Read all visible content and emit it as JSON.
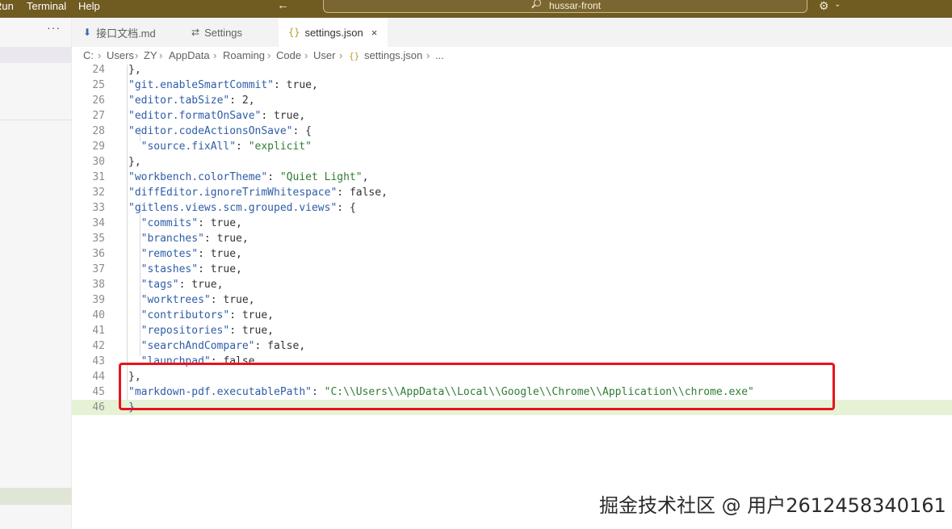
{
  "menubar": {
    "items": [
      {
        "label": "Run"
      },
      {
        "label": "Terminal"
      },
      {
        "label": "Help"
      }
    ],
    "search_text": "hussar-front"
  },
  "icons": {
    "back": "arrow-left-icon",
    "search": "search-icon",
    "account": "account-icon",
    "chevron": "chevron-down-icon",
    "more": "more-icon",
    "markdown_file": "download-arrow-icon",
    "settings": "settings-icon",
    "json_file": "json-braces-icon",
    "close": "close-icon"
  },
  "sidebar": {
    "more_label": "···"
  },
  "tabs": [
    {
      "label": "接口文档.md",
      "icon": "⬇"
    },
    {
      "label": "Settings",
      "icon": "⇄"
    },
    {
      "label": "settings.json",
      "icon": "{}",
      "close": "×"
    }
  ],
  "breadcrumb": {
    "items": [
      "C:",
      "Users",
      "ZY",
      "AppData",
      "Roaming",
      "Code",
      "User",
      "settings.json",
      "..."
    ],
    "separator": "›",
    "file_icon": "{}"
  },
  "editor": {
    "lines": [
      {
        "n": "24",
        "text": "  },"
      },
      {
        "n": "25",
        "key": "\"git.enableSmartCommit\"",
        "val": "true",
        "valtype": "kw",
        "tail": ","
      },
      {
        "n": "26",
        "key": "\"editor.tabSize\"",
        "val": "2",
        "valtype": "kw",
        "tail": ","
      },
      {
        "n": "27",
        "key": "\"editor.formatOnSave\"",
        "val": "true",
        "valtype": "kw",
        "tail": ","
      },
      {
        "n": "28",
        "key": "\"editor.codeActionsOnSave\"",
        "val": "{",
        "valtype": "kw",
        "tail": ""
      },
      {
        "n": "29",
        "key": "\"source.fixAll\"",
        "val": "\"explicit\"",
        "valtype": "str",
        "tail": "",
        "indent": 2
      },
      {
        "n": "30",
        "text": "},"
      },
      {
        "n": "31",
        "key": "\"workbench.colorTheme\"",
        "val": "\"Quiet Light\"",
        "valtype": "str",
        "tail": ","
      },
      {
        "n": "32",
        "key": "\"diffEditor.ignoreTrimWhitespace\"",
        "val": "false",
        "valtype": "kw",
        "tail": ","
      },
      {
        "n": "33",
        "key": "\"gitlens.views.scm.grouped.views\"",
        "val": "{",
        "valtype": "kw",
        "tail": ""
      },
      {
        "n": "34",
        "key": "\"commits\"",
        "val": "true",
        "valtype": "kw",
        "tail": ",",
        "indent": 2
      },
      {
        "n": "35",
        "key": "\"branches\"",
        "val": "true",
        "valtype": "kw",
        "tail": ",",
        "indent": 2
      },
      {
        "n": "36",
        "key": "\"remotes\"",
        "val": "true",
        "valtype": "kw",
        "tail": ",",
        "indent": 2
      },
      {
        "n": "37",
        "key": "\"stashes\"",
        "val": "true",
        "valtype": "kw",
        "tail": ",",
        "indent": 2
      },
      {
        "n": "38",
        "key": "\"tags\"",
        "val": "true",
        "valtype": "kw",
        "tail": ",",
        "indent": 2
      },
      {
        "n": "39",
        "key": "\"worktrees\"",
        "val": "true",
        "valtype": "kw",
        "tail": ",",
        "indent": 2
      },
      {
        "n": "40",
        "key": "\"contributors\"",
        "val": "true",
        "valtype": "kw",
        "tail": ",",
        "indent": 2
      },
      {
        "n": "41",
        "key": "\"repositories\"",
        "val": "true",
        "valtype": "kw",
        "tail": ",",
        "indent": 2
      },
      {
        "n": "42",
        "key": "\"searchAndCompare\"",
        "val": "false",
        "valtype": "kw",
        "tail": ",",
        "indent": 2
      },
      {
        "n": "43",
        "key": "\"launchpad\"",
        "val": "false",
        "valtype": "kw",
        "tail": "",
        "indent": 2
      },
      {
        "n": "44",
        "text": "},"
      },
      {
        "n": "45",
        "key": "\"markdown-pdf.executablePath\"",
        "val": "\"C:\\\\Users\\\\AppData\\\\Local\\\\Google\\\\Chrome\\\\Application\\\\chrome.exe\"",
        "valtype": "str",
        "tail": ""
      },
      {
        "n": "46",
        "text": "}",
        "current": true,
        "brace": true
      }
    ]
  },
  "watermark": "掘金技术社区 @ 用户2612458340161",
  "colors": {
    "titlebar": "#705b21",
    "highlight_box": "#e8141b",
    "current_line": "#e6f2d6",
    "json_key": "#2f5da8",
    "json_string": "#2f7d32"
  }
}
